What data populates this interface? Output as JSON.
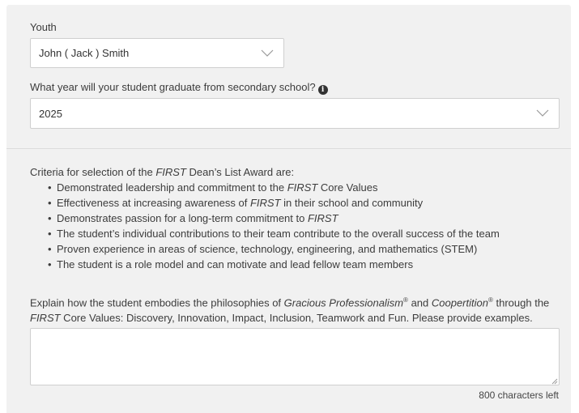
{
  "youth": {
    "label": "Youth",
    "selected": "John ( Jack ) Smith"
  },
  "graduation": {
    "label": "What year will your student graduate from secondary school?",
    "selected": "2025",
    "info_icon": "info-circle-icon"
  },
  "criteria": {
    "intro_before": "Criteria for selection of the ",
    "intro_first": "FIRST",
    "intro_after": " Dean’s List Award are:",
    "items": [
      {
        "before": "Demonstrated leadership and commitment to the ",
        "em": "FIRST",
        "after": " Core Values"
      },
      {
        "before": "Effectiveness at increasing awareness of ",
        "em": "FIRST",
        "after": " in their school and community"
      },
      {
        "before": "Demonstrates passion for a long-term commitment to ",
        "em": "FIRST",
        "after": ""
      },
      {
        "before": "The student’s individual contributions to their team contribute to the overall success of the team",
        "em": "",
        "after": ""
      },
      {
        "before": "Proven experience in areas of science, technology, engineering, and mathematics (STEM)",
        "em": "",
        "after": ""
      },
      {
        "before": "The student is a role model and can motivate and lead fellow team members",
        "em": "",
        "after": ""
      }
    ]
  },
  "explain": {
    "part1": "Explain how the student embodies the philosophies of ",
    "gp": "Gracious Professionalism",
    "reg": "®",
    "and": " and ",
    "coop": "Coopertition",
    "part2": " through the ",
    "first": "FIRST",
    "part3": " Core Values: Discovery, Innovation, Impact, Inclusion, Teamwork and Fun. Please provide examples.",
    "value": "",
    "counter": "800 characters left"
  },
  "colors": {
    "panel_bg": "#f1f1f1",
    "border": "#cfcfcf"
  }
}
